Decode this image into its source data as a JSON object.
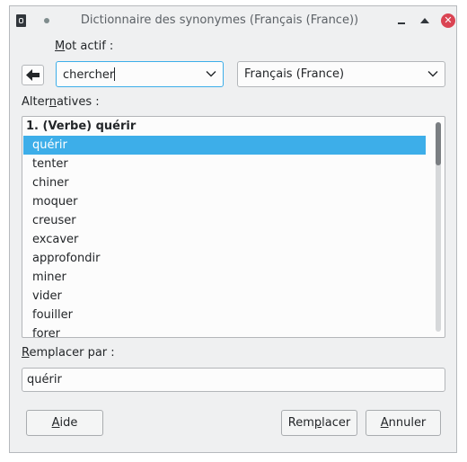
{
  "window": {
    "title": "Dictionnaire des synonymes (Français (France))",
    "close_glyph": "✕"
  },
  "word": {
    "label_first": "M",
    "label_rest": "ot actif :",
    "value": "chercher"
  },
  "language": {
    "selected": "Français (France)"
  },
  "alternatives": {
    "label_before": "Alter",
    "label_accel": "n",
    "label_after": "atives :",
    "items": [
      {
        "text": "1. (Verbe) quérir",
        "kind": "header",
        "selected": false
      },
      {
        "text": "quérir",
        "kind": "sub",
        "selected": true
      },
      {
        "text": "tenter",
        "kind": "sub",
        "selected": false
      },
      {
        "text": "chiner",
        "kind": "sub",
        "selected": false
      },
      {
        "text": "moquer",
        "kind": "sub",
        "selected": false
      },
      {
        "text": "creuser",
        "kind": "sub",
        "selected": false
      },
      {
        "text": "excaver",
        "kind": "sub",
        "selected": false
      },
      {
        "text": "approfondir",
        "kind": "sub",
        "selected": false
      },
      {
        "text": "miner",
        "kind": "sub",
        "selected": false
      },
      {
        "text": "vider",
        "kind": "sub",
        "selected": false
      },
      {
        "text": "fouiller",
        "kind": "sub",
        "selected": false
      },
      {
        "text": "forer",
        "kind": "sub",
        "selected": false
      }
    ],
    "scroll_position": 0
  },
  "replace": {
    "label_first": "R",
    "label_rest": "emplacer par :",
    "value": "quérir"
  },
  "buttons": {
    "help_first": "A",
    "help_rest": "ide",
    "replace_before": "Rem",
    "replace_accel": "p",
    "replace_after": "lacer",
    "cancel_first": "A",
    "cancel_rest": "nnuler"
  },
  "colors": {
    "accent": "#3daee9",
    "close": "#da4453",
    "window_bg": "#eff0f1"
  },
  "icons": {
    "back": "arrow-left-icon",
    "dropdown": "chevron-down-icon",
    "app": "libreoffice-writer-icon",
    "pin": "pin-dot-icon",
    "minimize": "minimize-icon",
    "maximize": "maximize-icon",
    "close": "close-icon"
  }
}
